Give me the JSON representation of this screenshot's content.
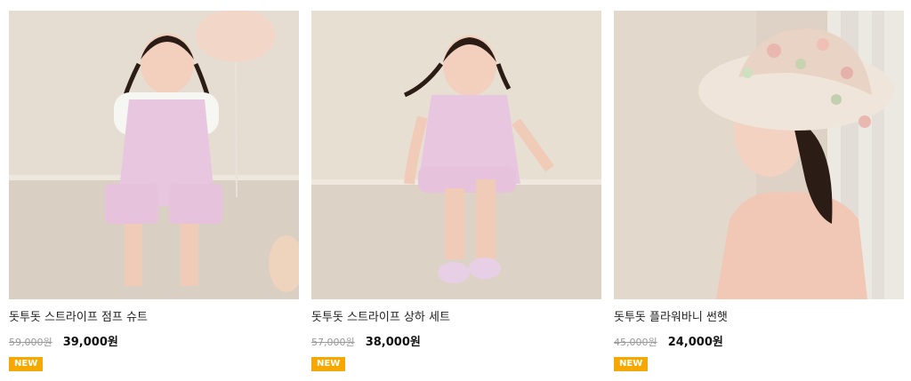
{
  "products": [
    {
      "name": "돗투돗 스트라이프 점프 슈트",
      "original_price": "59,000원",
      "sale_price": "39,000원",
      "badge": "NEW",
      "image_icon": "girl-in-pink-jumpsuit-photo"
    },
    {
      "name": "돗투돗 스트라이프 상하 세트",
      "original_price": "57,000원",
      "sale_price": "38,000원",
      "badge": "NEW",
      "image_icon": "girl-in-pink-set-photo"
    },
    {
      "name": "돗투돗 플라워바니 썬햇",
      "original_price": "45,000원",
      "sale_price": "24,000원",
      "badge": "NEW",
      "image_icon": "girl-in-sun-hat-photo"
    }
  ],
  "colors": {
    "badge": "#f6a800",
    "sale": "#111111",
    "original": "#9a9a9a"
  }
}
